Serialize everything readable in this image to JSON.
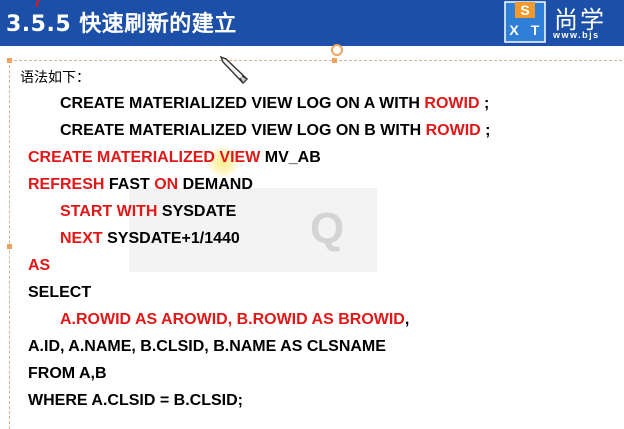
{
  "header": {
    "title": "3.5.5 快速刷新的建立",
    "logo_text": "尚学",
    "logo_url": "www.bjs",
    "logo_letters": {
      "s": "S",
      "x": "X",
      "t": "T"
    }
  },
  "colors": {
    "header_bg": "#1c4fa8",
    "keyword_red": "#e01818",
    "text": "#000000"
  },
  "content": {
    "intro": "语法如下：",
    "l1": {
      "a": "CREATE MATERIALIZED VIEW LOG ON A WITH ",
      "b": "ROWID",
      "c": " ;"
    },
    "l2": {
      "a": "CREATE MATERIALIZED VIEW LOG ON B WITH ",
      "b": "ROWID",
      "c": " ;"
    },
    "l3": {
      "a": "CREATE MATERIALIZED VIEW",
      "b": " MV_AB"
    },
    "l4": {
      "a": "REFRESH",
      "b": " FAST ",
      "c": "ON",
      "d": " DEMAND"
    },
    "l5": {
      "a": "START WITH",
      "b": " SYSDATE"
    },
    "l6": {
      "a": "NEXT",
      "b": " SYSDATE+1/1440"
    },
    "l7": {
      "a": "AS"
    },
    "l8": {
      "a": "SELECT"
    },
    "l9": {
      "a": "A.ROWID AS AROWID, B.ROWID AS BROWID",
      "b": ","
    },
    "l10": {
      "a": "A.ID, A.NAME, B.CLSID, B.NAME AS CLSNAME"
    },
    "l11": {
      "a": "FROM A,B"
    },
    "l12": {
      "a": "WHERE A.CLSID = B.CLSID;"
    }
  },
  "overlay": {
    "letter": "Q"
  }
}
